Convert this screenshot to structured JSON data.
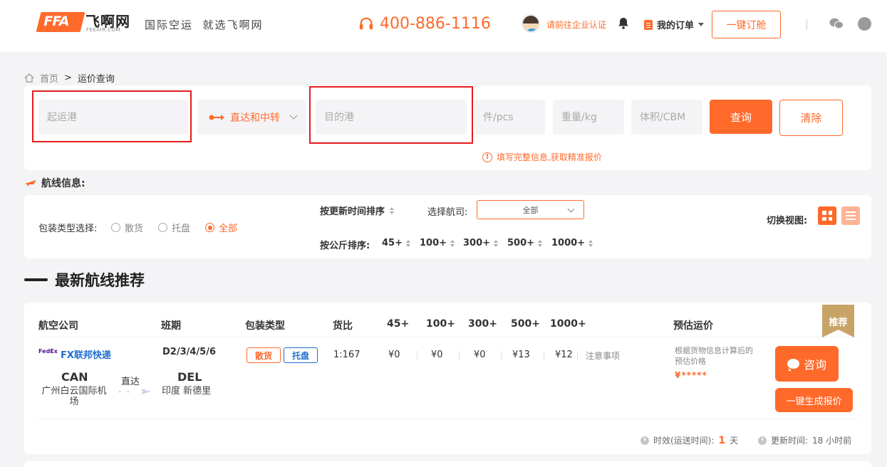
{
  "header": {
    "logo_mark": "FFA",
    "logo_cn": "飞啊网",
    "logo_en": "FEEAIR.COM",
    "slogan": "国际空运  就选飞啊网",
    "hotline": "400-886-1116",
    "verify_link": "请前往企业认证",
    "orders_label": "我的订单",
    "book_button": "一键订舱"
  },
  "breadcrumb": {
    "home": "首页",
    "separator": ">",
    "current": "运价查询"
  },
  "search": {
    "origin_placeholder": "起运港",
    "route_type": "直达和中转",
    "dest_placeholder": "目的港",
    "pcs_placeholder": "件/pcs",
    "weight_placeholder": "重量/kg",
    "volume_placeholder": "体积/CBM",
    "query_button": "查询",
    "clear_button": "清除",
    "hint": "填写完整信息,获取精准报价"
  },
  "filters": {
    "section_title": "航线信息:",
    "pack_type_label": "包装类型选择:",
    "pack_types": [
      {
        "label": "散货",
        "selected": false
      },
      {
        "label": "托盘",
        "selected": false
      },
      {
        "label": "全部",
        "selected": true
      }
    ],
    "sort_by_time": "按更新时间排序",
    "airline_label": "选择航司:",
    "airline_value": "全部",
    "sort_by_kg": "按公斤排序:",
    "kg_options": [
      "45+",
      "100+",
      "300+",
      "500+",
      "1000+"
    ],
    "view_label": "切换视图:"
  },
  "recommend": {
    "title": "最新航线推荐",
    "badge": "推荐",
    "columns": [
      "航空公司",
      "班期",
      "包装类型",
      "货比",
      "45+",
      "100+",
      "300+",
      "500+",
      "1000+",
      "预估运价"
    ],
    "row": {
      "carrier_logo": "FedEx",
      "carrier_name": "FX联邦快递",
      "schedule": "D2/3/4/5/6",
      "pack_tags": [
        "散货",
        "托盘"
      ],
      "ratio": "1:167",
      "prices": [
        "¥0",
        "¥0",
        "¥0",
        "¥13",
        "¥12"
      ],
      "notes": "注意事项",
      "estimate_text": "根据货物信息计算后的预估价格",
      "estimate_price": "¥*****",
      "consult_button": "咨询",
      "quote_button": "一键生成报价",
      "origin_code": "CAN",
      "origin_name": "广州白云国际机场",
      "route_mode": "直达",
      "dest_code": "DEL",
      "dest_name": "印度 新德里",
      "transit_label": "时效(运送时间):",
      "transit_days": "1",
      "transit_unit": "天",
      "updated_label": "更新时间:",
      "updated_value": "18 小时前"
    }
  },
  "colors": {
    "accent": "#ff6a2b",
    "link_blue": "#1e6fd0",
    "badge_gold": "#c8a368",
    "highlight_red": "#e51b1b"
  }
}
